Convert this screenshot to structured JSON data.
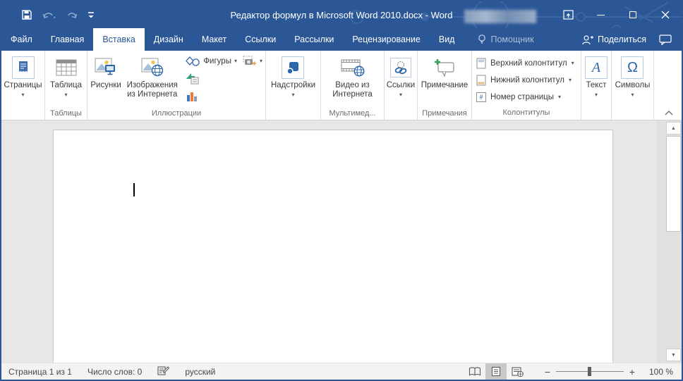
{
  "colors": {
    "accent_blue": "#2b5797",
    "icon_blue": "#2b66a8",
    "chart_orange": "#ed7d31",
    "smartart_green": "#2f9e7d",
    "comment_green": "#3aa05f",
    "footer_tan": "#dfc08a"
  },
  "titlebar": {
    "title": "Редактор формул в Microsoft Word 2010.docx  -  Word"
  },
  "tabs": [
    {
      "label": "Файл"
    },
    {
      "label": "Главная"
    },
    {
      "label": "Вставка"
    },
    {
      "label": "Дизайн"
    },
    {
      "label": "Макет"
    },
    {
      "label": "Ссылки"
    },
    {
      "label": "Рассылки"
    },
    {
      "label": "Рецензирование"
    },
    {
      "label": "Вид"
    }
  ],
  "assistant": {
    "label": "Помощник"
  },
  "share": {
    "label": "Поделиться"
  },
  "ribbon": {
    "pages": {
      "button": "Страницы"
    },
    "tables": {
      "button": "Таблица",
      "group_label": "Таблицы"
    },
    "illustrations": {
      "pictures": "Рисунки",
      "online_pictures": "Изображения из Интернета",
      "shapes": "Фигуры",
      "group_label": "Иллюстрации"
    },
    "addins": {
      "button": "Надстройки"
    },
    "media": {
      "online_video": "Видео из Интернета",
      "group_label": "Мультимед..."
    },
    "links": {
      "button": "Ссылки"
    },
    "comments": {
      "button": "Примечание",
      "group_label": "Примечания"
    },
    "header_footer": {
      "header": "Верхний колонтитул",
      "footer": "Нижний колонтитул",
      "page_number": "Номер страницы",
      "group_label": "Колонтитулы"
    },
    "text": {
      "button": "Текст"
    },
    "symbols": {
      "button": "Символы"
    }
  },
  "glyphs": {
    "dropdown": "▾",
    "omega": "Ω",
    "letter_a": "A",
    "hash": "#",
    "minus": "−",
    "plus": "+",
    "scroll_up": "▲",
    "scroll_down": "▼"
  },
  "statusbar": {
    "page_info": "Страница 1 из 1",
    "word_count": "Число слов: 0",
    "language": "русский",
    "zoom_level": "100 %"
  }
}
